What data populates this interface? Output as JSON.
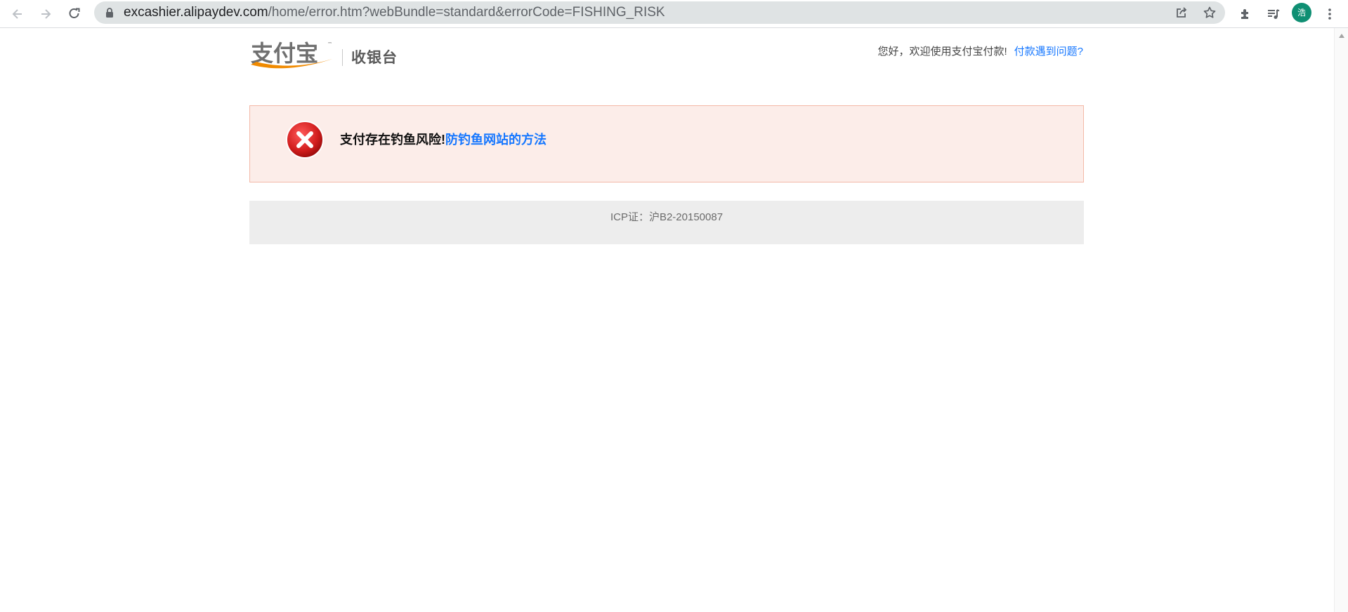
{
  "browser": {
    "url_host": "excashier.alipaydev.com",
    "url_path": "/home/error.htm?webBundle=standard&errorCode=FISHING_RISK",
    "avatar_char": "浩",
    "icons": [
      "back-icon",
      "forward-icon",
      "reload-icon",
      "lock-icon",
      "share-icon",
      "star-icon",
      "extensions-icon",
      "media-icon",
      "menu-icon"
    ]
  },
  "header": {
    "logo_text": "支付宝",
    "logo_tm": "™",
    "logo_sub": "收银台",
    "greeting": "您好，欢迎使用支付宝付款!",
    "help_link": "付款遇到问题?"
  },
  "alert": {
    "message": "支付存在钓鱼风险!",
    "link": "防钓鱼网站的方法"
  },
  "footer": {
    "icp": "ICP证：沪B2-20150087"
  },
  "colors": {
    "link": "#1677ff",
    "alert_bg": "#fcede9",
    "alert_border": "#f3b9a7",
    "error_red": "#d11d1d",
    "logo_orange": "#f08a00",
    "logo_text": "#707070"
  }
}
